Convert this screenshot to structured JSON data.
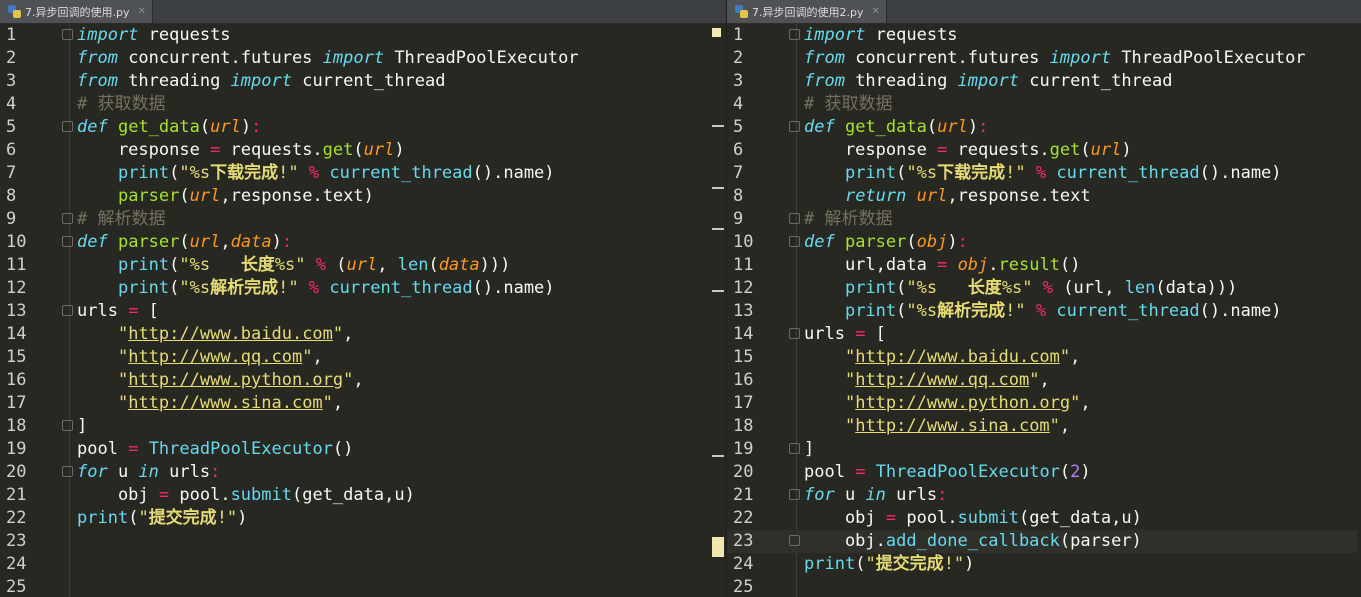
{
  "tabs": {
    "left": "7.异步回调的使用.py",
    "right": "7.异步回调的使用2.py"
  },
  "editor_left": {
    "line_numbers": [
      "1",
      "2",
      "3",
      "4",
      "5",
      "6",
      "7",
      "8",
      "9",
      "10",
      "11",
      "12",
      "13",
      "14",
      "15",
      "16",
      "17",
      "18",
      "19",
      "20",
      "21",
      "22",
      "23",
      "24",
      "25"
    ]
  },
  "editor_right": {
    "line_numbers": [
      "1",
      "2",
      "3",
      "4",
      "5",
      "6",
      "7",
      "8",
      "9",
      "10",
      "11",
      "12",
      "13",
      "14",
      "15",
      "16",
      "17",
      "18",
      "19",
      "20",
      "21",
      "22",
      "23",
      "24",
      "25"
    ]
  },
  "colors": {
    "background": "#272822",
    "keyword": "#66d9ef",
    "function": "#a6e22e",
    "string": "#e6db74",
    "operator": "#f92672",
    "comment": "#75715e",
    "param": "#fd971f",
    "number": "#ae81ff"
  },
  "code_left": [
    [
      [
        "kw",
        "import"
      ],
      [
        "pl",
        " requests"
      ]
    ],
    [
      [
        "kw",
        "from"
      ],
      [
        "pl",
        " concurrent.futures "
      ],
      [
        "kw",
        "import"
      ],
      [
        "pl",
        " ThreadPoolExecutor"
      ]
    ],
    [
      [
        "kw",
        "from"
      ],
      [
        "pl",
        " threading "
      ],
      [
        "kw",
        "import"
      ],
      [
        "pl",
        " current_thread"
      ]
    ],
    [
      [
        "cm",
        "# 获取数据"
      ]
    ],
    [
      [
        "def",
        "def"
      ],
      [
        "pl",
        " "
      ],
      [
        "fn",
        "get_data"
      ],
      [
        "pl",
        "("
      ],
      [
        "param",
        "url"
      ],
      [
        "pl",
        ")"
      ],
      [
        "op",
        ":"
      ]
    ],
    [
      [
        "pl",
        "    response "
      ],
      [
        "op",
        "="
      ],
      [
        "pl",
        " requests."
      ],
      [
        "fn",
        "get"
      ],
      [
        "pl",
        "("
      ],
      [
        "param",
        "url"
      ],
      [
        "pl",
        ")"
      ]
    ],
    [
      [
        "pl",
        "    "
      ],
      [
        "bi",
        "print"
      ],
      [
        "pl",
        "("
      ],
      [
        "str",
        "\"%s"
      ],
      [
        "strb",
        "下载完成"
      ],
      [
        "str",
        "!\""
      ],
      [
        "pl",
        " "
      ],
      [
        "op",
        "%"
      ],
      [
        "pl",
        " "
      ],
      [
        "bi",
        "current_thread"
      ],
      [
        "pl",
        "().name)"
      ]
    ],
    [
      [
        "pl",
        "    "
      ],
      [
        "fn",
        "parser"
      ],
      [
        "pl",
        "("
      ],
      [
        "param",
        "url"
      ],
      [
        "pl",
        ",response.text)"
      ]
    ],
    [
      [
        "cm",
        "# 解析数据"
      ]
    ],
    [
      [
        "def",
        "def"
      ],
      [
        "pl",
        " "
      ],
      [
        "fn",
        "parser"
      ],
      [
        "pl",
        "("
      ],
      [
        "param",
        "url"
      ],
      [
        "pl",
        ","
      ],
      [
        "param",
        "data"
      ],
      [
        "pl",
        ")"
      ],
      [
        "op",
        ":"
      ]
    ],
    [
      [
        "pl",
        "    "
      ],
      [
        "bi",
        "print"
      ],
      [
        "pl",
        "("
      ],
      [
        "str",
        "\"%s   "
      ],
      [
        "strb",
        "长度"
      ],
      [
        "str",
        "%s\""
      ],
      [
        "pl",
        " "
      ],
      [
        "op",
        "%"
      ],
      [
        "pl",
        " ("
      ],
      [
        "param",
        "url"
      ],
      [
        "pl",
        ", "
      ],
      [
        "bi",
        "len"
      ],
      [
        "pl",
        "("
      ],
      [
        "param",
        "data"
      ],
      [
        "pl",
        ")))"
      ]
    ],
    [
      [
        "pl",
        "    "
      ],
      [
        "bi",
        "print"
      ],
      [
        "pl",
        "("
      ],
      [
        "str",
        "\"%s"
      ],
      [
        "strb",
        "解析完成"
      ],
      [
        "str",
        "!\""
      ],
      [
        "pl",
        " "
      ],
      [
        "op",
        "%"
      ],
      [
        "pl",
        " "
      ],
      [
        "bi",
        "current_thread"
      ],
      [
        "pl",
        "().name)"
      ]
    ],
    [
      [
        "pl",
        "urls "
      ],
      [
        "op",
        "="
      ],
      [
        "pl",
        " ["
      ]
    ],
    [
      [
        "pl",
        "    "
      ],
      [
        "str",
        "\""
      ],
      [
        "link",
        "http://www.baidu.com"
      ],
      [
        "str",
        "\""
      ],
      [
        "pl",
        ","
      ]
    ],
    [
      [
        "pl",
        "    "
      ],
      [
        "str",
        "\""
      ],
      [
        "link",
        "http://www.qq.com"
      ],
      [
        "str",
        "\""
      ],
      [
        "pl",
        ","
      ]
    ],
    [
      [
        "pl",
        "    "
      ],
      [
        "str",
        "\""
      ],
      [
        "link",
        "http://www.python.org"
      ],
      [
        "str",
        "\""
      ],
      [
        "pl",
        ","
      ]
    ],
    [
      [
        "pl",
        "    "
      ],
      [
        "str",
        "\""
      ],
      [
        "link",
        "http://www.sina.com"
      ],
      [
        "str",
        "\""
      ],
      [
        "pl",
        ","
      ]
    ],
    [
      [
        "pl",
        "]"
      ]
    ],
    [
      [
        "pl",
        "pool "
      ],
      [
        "op",
        "="
      ],
      [
        "pl",
        " "
      ],
      [
        "bi",
        "ThreadPoolExecutor"
      ],
      [
        "pl",
        "()"
      ]
    ],
    [
      [
        "kw",
        "for"
      ],
      [
        "pl",
        " u "
      ],
      [
        "kw",
        "in"
      ],
      [
        "pl",
        " urls"
      ],
      [
        "op",
        ":"
      ]
    ],
    [
      [
        "pl",
        "    obj "
      ],
      [
        "op",
        "="
      ],
      [
        "pl",
        " pool."
      ],
      [
        "bi",
        "submit"
      ],
      [
        "pl",
        "(get_data,u)"
      ]
    ],
    [
      [
        "bi",
        "print"
      ],
      [
        "pl",
        "("
      ],
      [
        "str",
        "\""
      ],
      [
        "strb",
        "提交完成"
      ],
      [
        "str",
        "!\""
      ],
      [
        "pl",
        ")"
      ]
    ],
    [],
    [],
    []
  ],
  "code_right": [
    [
      [
        "kw",
        "import"
      ],
      [
        "pl",
        " requests"
      ]
    ],
    [
      [
        "kw",
        "from"
      ],
      [
        "pl",
        " concurrent.futures "
      ],
      [
        "kw",
        "import"
      ],
      [
        "pl",
        " ThreadPoolExecutor"
      ]
    ],
    [
      [
        "kw",
        "from"
      ],
      [
        "pl",
        " threading "
      ],
      [
        "kw",
        "import"
      ],
      [
        "pl",
        " current_thread"
      ]
    ],
    [
      [
        "cm",
        "# 获取数据"
      ]
    ],
    [
      [
        "def",
        "def"
      ],
      [
        "pl",
        " "
      ],
      [
        "fn",
        "get_data"
      ],
      [
        "pl",
        "("
      ],
      [
        "param",
        "url"
      ],
      [
        "pl",
        ")"
      ],
      [
        "op",
        ":"
      ]
    ],
    [
      [
        "pl",
        "    response "
      ],
      [
        "op",
        "="
      ],
      [
        "pl",
        " requests."
      ],
      [
        "fn",
        "get"
      ],
      [
        "pl",
        "("
      ],
      [
        "param",
        "url"
      ],
      [
        "pl",
        ")"
      ]
    ],
    [
      [
        "pl",
        "    "
      ],
      [
        "bi",
        "print"
      ],
      [
        "pl",
        "("
      ],
      [
        "str",
        "\"%s"
      ],
      [
        "strb",
        "下载完成"
      ],
      [
        "str",
        "!\""
      ],
      [
        "pl",
        " "
      ],
      [
        "op",
        "%"
      ],
      [
        "pl",
        " "
      ],
      [
        "bi",
        "current_thread"
      ],
      [
        "pl",
        "().name)"
      ]
    ],
    [
      [
        "pl",
        "    "
      ],
      [
        "kw",
        "return"
      ],
      [
        "pl",
        " "
      ],
      [
        "param",
        "url"
      ],
      [
        "pl",
        ",response.text"
      ]
    ],
    [
      [
        "cm",
        "# 解析数据"
      ]
    ],
    [
      [
        "def",
        "def"
      ],
      [
        "pl",
        " "
      ],
      [
        "fn",
        "parser"
      ],
      [
        "pl",
        "("
      ],
      [
        "param",
        "obj"
      ],
      [
        "pl",
        ")"
      ],
      [
        "op",
        ":"
      ]
    ],
    [
      [
        "pl",
        "    url,data "
      ],
      [
        "op",
        "="
      ],
      [
        "pl",
        " "
      ],
      [
        "param",
        "obj"
      ],
      [
        "pl",
        "."
      ],
      [
        "fn",
        "result"
      ],
      [
        "pl",
        "()"
      ]
    ],
    [
      [
        "pl",
        "    "
      ],
      [
        "bi",
        "print"
      ],
      [
        "pl",
        "("
      ],
      [
        "str",
        "\"%s   "
      ],
      [
        "strb",
        "长度"
      ],
      [
        "str",
        "%s\""
      ],
      [
        "pl",
        " "
      ],
      [
        "op",
        "%"
      ],
      [
        "pl",
        " (url, "
      ],
      [
        "bi",
        "len"
      ],
      [
        "pl",
        "(data)))"
      ]
    ],
    [
      [
        "pl",
        "    "
      ],
      [
        "bi",
        "print"
      ],
      [
        "pl",
        "("
      ],
      [
        "str",
        "\"%s"
      ],
      [
        "strb",
        "解析完成"
      ],
      [
        "str",
        "!\""
      ],
      [
        "pl",
        " "
      ],
      [
        "op",
        "%"
      ],
      [
        "pl",
        " "
      ],
      [
        "bi",
        "current_thread"
      ],
      [
        "pl",
        "().name)"
      ]
    ],
    [
      [
        "pl",
        "urls "
      ],
      [
        "op",
        "="
      ],
      [
        "pl",
        " ["
      ]
    ],
    [
      [
        "pl",
        "    "
      ],
      [
        "str",
        "\""
      ],
      [
        "link",
        "http://www.baidu.com"
      ],
      [
        "str",
        "\""
      ],
      [
        "pl",
        ","
      ]
    ],
    [
      [
        "pl",
        "    "
      ],
      [
        "str",
        "\""
      ],
      [
        "link",
        "http://www.qq.com"
      ],
      [
        "str",
        "\""
      ],
      [
        "pl",
        ","
      ]
    ],
    [
      [
        "pl",
        "    "
      ],
      [
        "str",
        "\""
      ],
      [
        "link",
        "http://www.python.org"
      ],
      [
        "str",
        "\""
      ],
      [
        "pl",
        ","
      ]
    ],
    [
      [
        "pl",
        "    "
      ],
      [
        "str",
        "\""
      ],
      [
        "link",
        "http://www.sina.com"
      ],
      [
        "str",
        "\""
      ],
      [
        "pl",
        ","
      ]
    ],
    [
      [
        "pl",
        "]"
      ]
    ],
    [
      [
        "pl",
        "pool "
      ],
      [
        "op",
        "="
      ],
      [
        "pl",
        " "
      ],
      [
        "bi",
        "ThreadPoolExecutor"
      ],
      [
        "pl",
        "("
      ],
      [
        "num",
        "2"
      ],
      [
        "pl",
        ")"
      ]
    ],
    [
      [
        "kw",
        "for"
      ],
      [
        "pl",
        " u "
      ],
      [
        "kw",
        "in"
      ],
      [
        "pl",
        " urls"
      ],
      [
        "op",
        ":"
      ]
    ],
    [
      [
        "pl",
        "    obj "
      ],
      [
        "op",
        "="
      ],
      [
        "pl",
        " pool."
      ],
      [
        "bi",
        "submit"
      ],
      [
        "pl",
        "(get_data,u)"
      ]
    ],
    [
      [
        "pl",
        "    obj."
      ],
      [
        "bi",
        "add_done_callback"
      ],
      [
        "pl",
        "(parser)"
      ]
    ],
    [
      [
        "bi",
        "print"
      ],
      [
        "pl",
        "("
      ],
      [
        "str",
        "\""
      ],
      [
        "strb",
        "提交完成"
      ],
      [
        "str",
        "!\""
      ],
      [
        "pl",
        ")"
      ]
    ],
    []
  ]
}
